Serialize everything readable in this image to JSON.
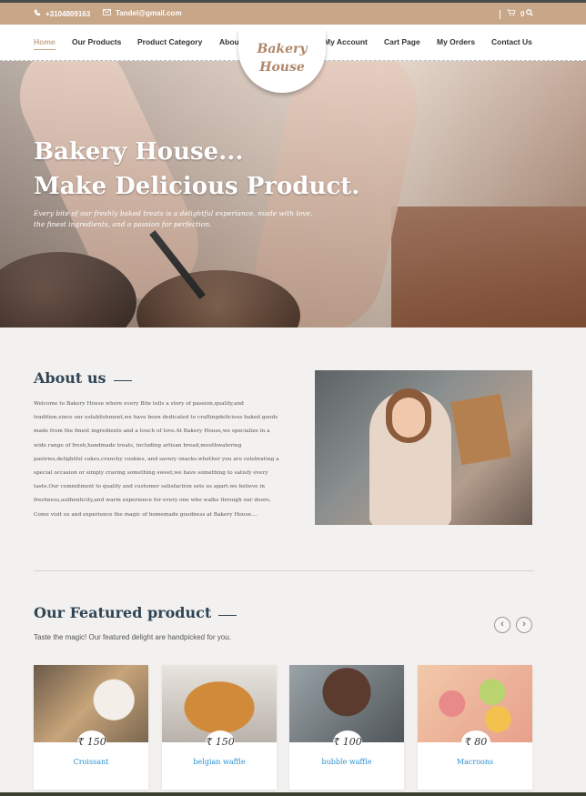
{
  "topbar": {
    "phone": "+3104809163",
    "email": "Tandel@gmail.com",
    "cart_count": "0",
    "icons": [
      "phone-icon",
      "mail-icon",
      "cart-icon",
      "search-icon"
    ]
  },
  "nav": {
    "items": [
      {
        "label": "Home",
        "active": true
      },
      {
        "label": "Our Products"
      },
      {
        "label": "Product Category"
      },
      {
        "label": "About Us"
      },
      {
        "label": "My Account"
      },
      {
        "label": "Cart Page"
      },
      {
        "label": "My Orders"
      },
      {
        "label": "Contact Us"
      }
    ],
    "logo_line1": "Bakery",
    "logo_line2": "House"
  },
  "hero": {
    "title_line1": "Bakery House...",
    "title_line2": "Make Delicious Product.",
    "subtitle": "Every bite of our freshly baked treats is a delightful experiance, made with love, the finest ingredients, and a passion for perfection."
  },
  "about": {
    "title": "About us",
    "text": "Welcome to Bakery House where every Bite tells a story of passion,quality,and tradition.since our establishment,we have been dedicated to craftingdelicious baked goods made from the finest ingredients and a touch of love.At Bakery House,we specialize in a wide range of fresh,handmade treats, including artisan bread,mouthwatering pastries,delightful cakes,crunchy cookies, and savery snacks.whether you are celebrating a special occasion or simply craving something sweet,we have something to satisfy every taste.Our commitment to quality and customer satisfaction sets us apart.we believe in freshness,authenticity,and warm experience for every one who walks through our doors. Come visit us and experience the magic of homemade goodness at Bakery House...."
  },
  "featured": {
    "title": "Our Featured product",
    "subtitle": "Taste the magic! Our featured delight are handpicked for you.",
    "products": [
      {
        "name": "Croissant",
        "price": "₹ 150"
      },
      {
        "name": "belgian waffle",
        "price": "₹ 150"
      },
      {
        "name": "bubble waffle",
        "price": "₹ 100"
      },
      {
        "name": "Macroons",
        "price": "₹ 80"
      }
    ]
  },
  "colors": {
    "accent": "#c8a688",
    "heading": "#2f4454",
    "link": "#2a8fcf"
  }
}
